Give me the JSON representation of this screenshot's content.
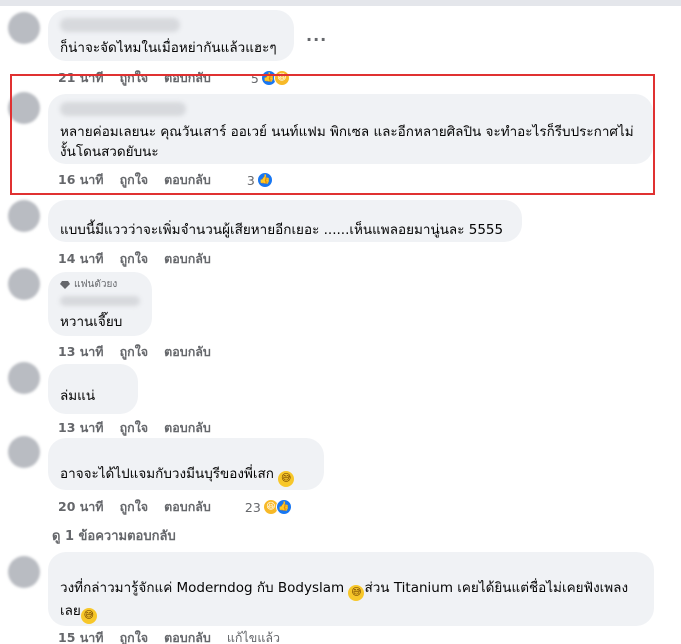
{
  "comments": [
    {
      "text": "ก็น่าจะจัดไหมในเมื่อหย่ากันแล้วแฮะๆ",
      "time": "21 นาที",
      "like_label": "ถูกใจ",
      "reply_label": "ตอบกลับ",
      "reaction_count": "5",
      "reactions": [
        "like-icon",
        "haha-icon"
      ]
    },
    {
      "text": "หลายค่อมเลยนะ คุณวันเสาร์ ออเวย์ นนท์แฟม พิกเซล และอีกหลายศิลปิน จะทำอะไรก็รีบประกาศไม่งั้นโดนสวดยับนะ",
      "time": "16 นาที",
      "like_label": "ถูกใจ",
      "reply_label": "ตอบกลับ",
      "reaction_count": "3",
      "reactions": [
        "like-icon"
      ]
    },
    {
      "text": "แบบนี้มีแววว่าจะเพิ่มจำนวนผู้เสียหายอีกเยอะ ......เห็นแพลอยมานู่นละ 5555",
      "time": "14 นาที",
      "like_label": "ถูกใจ",
      "reply_label": "ตอบกลับ"
    },
    {
      "badge": "แฟนตัวยง",
      "text": "หวานเจี๊ยบ",
      "time": "13 นาที",
      "like_label": "ถูกใจ",
      "reply_label": "ตอบกลับ"
    },
    {
      "text": "ล่มแน่",
      "time": "13 นาที",
      "like_label": "ถูกใจ",
      "reply_label": "ตอบกลับ"
    },
    {
      "text": "อาจจะได้ไปแจมกับวงมีนบุรีของพี่เสก",
      "time": "20 นาที",
      "like_label": "ถูกใจ",
      "reply_label": "ตอบกลับ",
      "reaction_count": "23",
      "reactions": [
        "haha-icon",
        "like-icon"
      ]
    },
    {
      "text_part1": "วงที่กล่าวมารู้จักแค่ Moderndog กับ Bodyslam",
      "text_part2": "ส่วน Titanium เคยได้ยินแต่ชื่อไม่เคยฟังเพลงเลย",
      "time": "15 นาที",
      "like_label": "ถูกใจ",
      "reply_label": "ตอบกลับ",
      "edited_label": "แก้ไขแล้ว"
    }
  ],
  "view_replies": "ดู 1 ข้อความตอบกลับ",
  "more_options": "...",
  "colors": {
    "highlight": "#e03131",
    "bubble": "#f0f2f5",
    "meta": "#65676b",
    "like": "#1877f2",
    "haha": "#f7b928"
  }
}
